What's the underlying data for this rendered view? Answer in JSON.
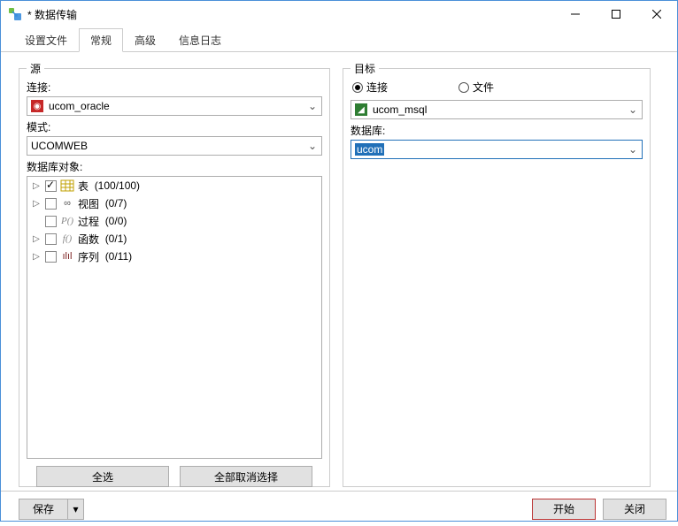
{
  "window": {
    "title": "* 数据传输"
  },
  "tabs": {
    "t0": "设置文件",
    "t1": "常规",
    "t2": "高级",
    "t3": "信息日志"
  },
  "source": {
    "group_title": "源",
    "conn_label": "连接:",
    "conn_value": "ucom_oracle",
    "schema_label": "模式:",
    "schema_value": "UCOMWEB",
    "objects_label": "数据库对象:",
    "tree": {
      "r0": {
        "label": "表",
        "count": "(100/100)"
      },
      "r1": {
        "label": "视图",
        "count": "(0/7)"
      },
      "r2": {
        "label": "过程",
        "count": "(0/0)"
      },
      "r3": {
        "label": "函数",
        "count": "(0/1)"
      },
      "r4": {
        "label": "序列",
        "count": "(0/11)"
      }
    },
    "select_all": "全选",
    "deselect_all": "全部取消选择"
  },
  "target": {
    "group_title": "目标",
    "radio_conn": "连接",
    "radio_file": "文件",
    "conn_value": "ucom_msql",
    "db_label": "数据库:",
    "db_value": "ucom"
  },
  "footer": {
    "save": "保存",
    "start": "开始",
    "close": "关闭"
  }
}
